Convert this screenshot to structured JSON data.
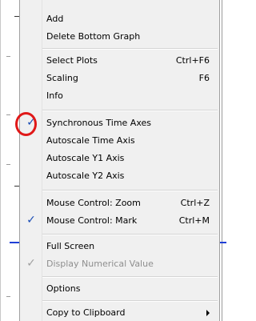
{
  "menu": {
    "items": [
      {
        "label": "Add",
        "shortcut": "",
        "checked": false,
        "disabled": false,
        "submenu": false
      },
      {
        "label": "Delete Bottom Graph",
        "shortcut": "",
        "checked": false,
        "disabled": false,
        "submenu": false
      },
      {
        "label": "Select Plots",
        "shortcut": "Ctrl+F6",
        "checked": false,
        "disabled": false,
        "submenu": false
      },
      {
        "label": "Scaling",
        "shortcut": "F6",
        "checked": false,
        "disabled": false,
        "submenu": false
      },
      {
        "label": "Info",
        "shortcut": "",
        "checked": false,
        "disabled": false,
        "submenu": false
      },
      {
        "label": "Synchronous Time Axes",
        "shortcut": "",
        "checked": true,
        "disabled": false,
        "submenu": false
      },
      {
        "label": "Autoscale Time Axis",
        "shortcut": "",
        "checked": false,
        "disabled": false,
        "submenu": false
      },
      {
        "label": "Autoscale Y1 Axis",
        "shortcut": "",
        "checked": false,
        "disabled": false,
        "submenu": false
      },
      {
        "label": "Autoscale Y2 Axis",
        "shortcut": "",
        "checked": false,
        "disabled": false,
        "submenu": false
      },
      {
        "label": "Mouse Control: Zoom",
        "shortcut": "Ctrl+Z",
        "checked": false,
        "disabled": false,
        "submenu": false
      },
      {
        "label": "Mouse Control: Mark",
        "shortcut": "Ctrl+M",
        "checked": true,
        "disabled": false,
        "submenu": false
      },
      {
        "label": "Full Screen",
        "shortcut": "",
        "checked": false,
        "disabled": false,
        "submenu": false
      },
      {
        "label": "Display Numerical Value",
        "shortcut": "",
        "checked": true,
        "disabled": true,
        "submenu": false
      },
      {
        "label": "Options",
        "shortcut": "",
        "checked": false,
        "disabled": false,
        "submenu": false
      },
      {
        "label": "Copy to Clipboard",
        "shortcut": "",
        "checked": false,
        "disabled": false,
        "submenu": true
      }
    ],
    "check_glyph": "✓",
    "highlight_color": "#e01818",
    "check_color": "#1a4cb5"
  }
}
